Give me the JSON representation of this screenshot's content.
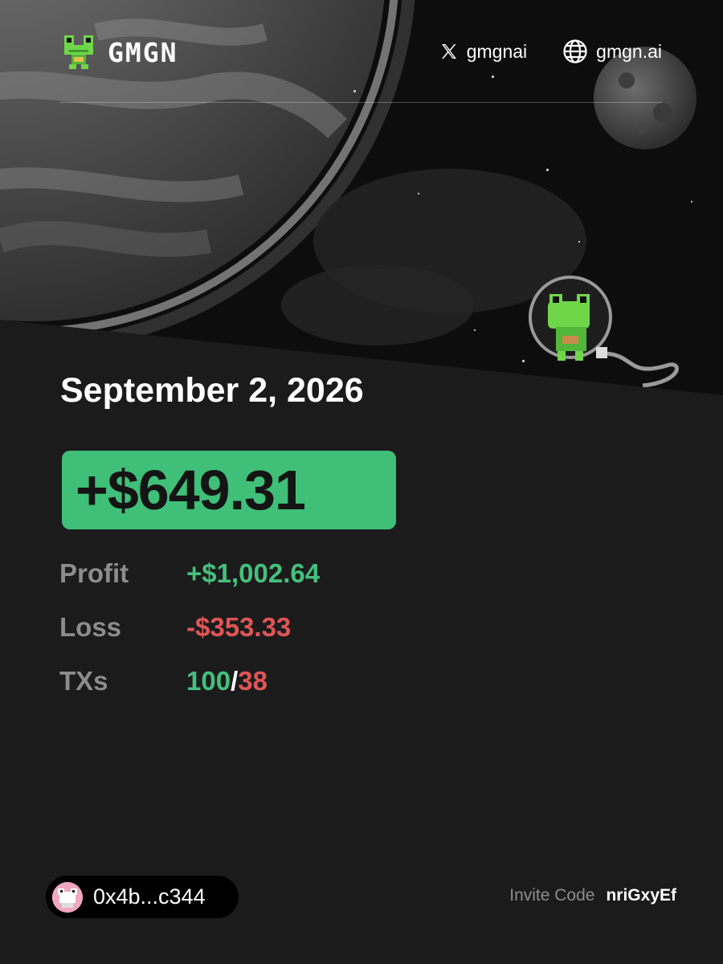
{
  "brand": {
    "name": "GMGN",
    "logo_icon": "frog-logo-icon"
  },
  "social": {
    "x_handle": "gmgnai",
    "x_icon": "x-logo-icon",
    "website": "gmgn.ai",
    "website_icon": "globe-icon"
  },
  "report": {
    "date": "September 2, 2026",
    "pnl": "+$649.31",
    "stats": {
      "profit_label": "Profit",
      "profit_value": "+$1,002.64",
      "loss_label": "Loss",
      "loss_value": "-$353.33",
      "txs_label": "TXs",
      "txs_wins": "100",
      "txs_separator": "/",
      "txs_losses": "38"
    }
  },
  "footer": {
    "wallet_address": "0x4b...c344",
    "invite_label": "Invite Code",
    "invite_code": "nriGxyEf"
  },
  "colors": {
    "background": "#1b1b1c",
    "pnl_badge": "#3fbf78",
    "positive": "#44c07d",
    "negative": "#e05555",
    "muted": "#8c8c8c"
  }
}
